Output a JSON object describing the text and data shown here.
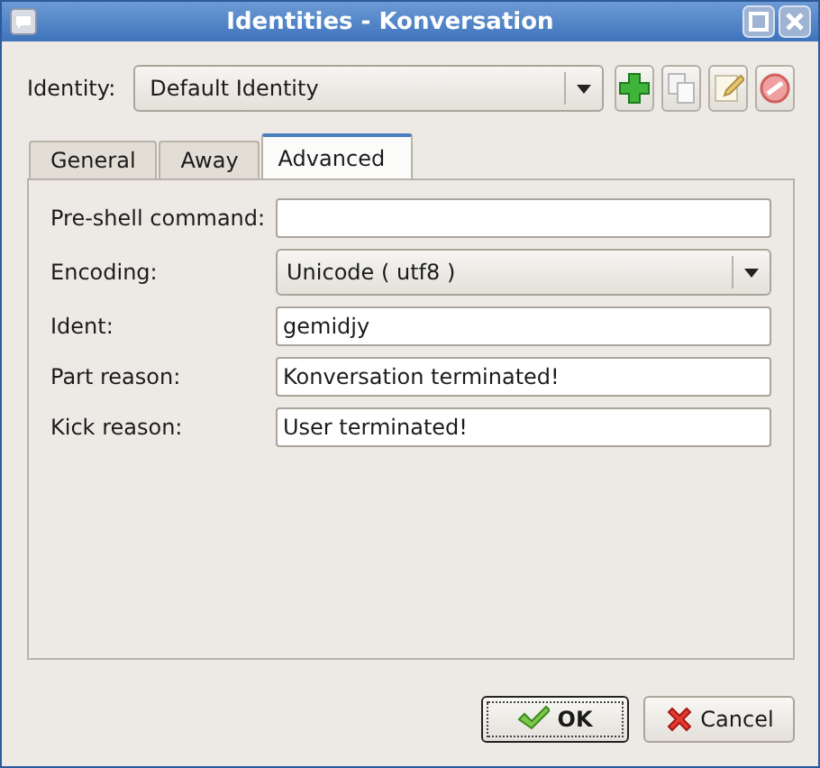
{
  "window": {
    "title": "Identities - Konversation"
  },
  "identity": {
    "label": "Identity:",
    "value": "Default Identity"
  },
  "toolbar": [
    {
      "kind": "add",
      "disabled": false
    },
    {
      "kind": "copy",
      "disabled": false
    },
    {
      "kind": "edit",
      "disabled": false
    },
    {
      "kind": "delete",
      "disabled": false
    }
  ],
  "tabs": [
    {
      "label": "General",
      "selected": false
    },
    {
      "label": "Away",
      "selected": false
    },
    {
      "label": "Advanced",
      "selected": true
    }
  ],
  "fields": [
    {
      "kind": "text",
      "label": "Pre-shell command:"
    },
    {
      "kind": "combo",
      "label": "Encoding:",
      "value": "Unicode ( utf8 )"
    },
    {
      "kind": "text",
      "label": "Ident:",
      "value": "gemidjy"
    },
    {
      "kind": "text",
      "label": "Part reason:",
      "value": "Konversation terminated!"
    },
    {
      "kind": "text",
      "label": "Kick reason:",
      "value": "User terminated!"
    }
  ],
  "buttons": [
    {
      "kind": "ok",
      "label": "OK",
      "default": true
    },
    {
      "kind": "cancel",
      "label": "Cancel",
      "default": false
    }
  ]
}
